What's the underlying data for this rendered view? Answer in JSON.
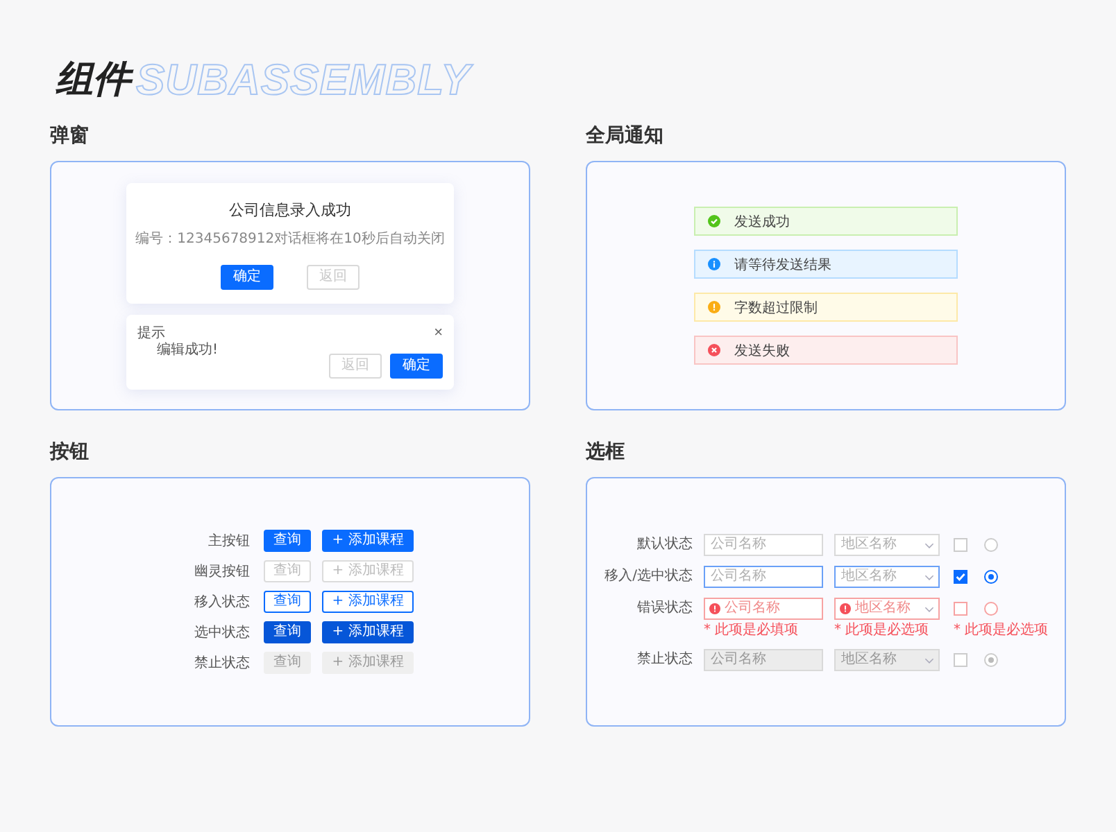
{
  "page_title": "组件",
  "watermark": "SUBASSEMBLY",
  "dialogs": {
    "title": "弹窗",
    "items": [
      {
        "kind": "result",
        "title": "公司信息录入成功",
        "message": "编号：12345678912对话框将在10秒后自动关闭",
        "buttons": [
          {
            "label": "确定",
            "primary": true
          },
          {
            "label": "返回",
            "primary": false
          }
        ]
      },
      {
        "kind": "prompt",
        "title": "提示",
        "message": "编辑成功!",
        "close": "×",
        "buttons": [
          {
            "label": "返回",
            "primary": false
          },
          {
            "label": "确定",
            "primary": true
          }
        ]
      }
    ]
  },
  "notifications": {
    "title": "全局通知",
    "items": [
      {
        "kind": "success",
        "text": "发送成功"
      },
      {
        "kind": "info",
        "text": "请等待发送结果"
      },
      {
        "kind": "warning",
        "text": "字数超过限制"
      },
      {
        "kind": "error",
        "text": "发送失败"
      }
    ]
  },
  "buttons": {
    "title": "按钮",
    "rows": [
      {
        "label": "主按钮",
        "kind": "primary",
        "buttons": [
          "查询",
          "+ 添加课程"
        ]
      },
      {
        "label": "幽灵按钮",
        "kind": "ghost",
        "buttons": [
          "查询",
          "+ 添加课程"
        ]
      },
      {
        "label": "移入状态",
        "kind": "hover",
        "buttons": [
          "查询",
          "+ 添加课程"
        ]
      },
      {
        "label": "选中状态",
        "kind": "active",
        "buttons": [
          "查询",
          "+ 添加课程"
        ]
      },
      {
        "label": "禁止状态",
        "kind": "disabled",
        "buttons": [
          "查询",
          "+ 添加课程"
        ]
      }
    ]
  },
  "fields": {
    "title": "选框",
    "rows": [
      {
        "label": "默认状态",
        "kind": "default",
        "input": {
          "placeholder": "公司名称"
        },
        "select": {
          "placeholder": "地区名称"
        },
        "checked": false,
        "selected": false
      },
      {
        "label": "移入/选中状态",
        "kind": "focus",
        "input": {
          "placeholder": "公司名称"
        },
        "select": {
          "placeholder": "地区名称"
        },
        "checked": true,
        "selected": true
      },
      {
        "label": "错误状态",
        "kind": "error",
        "input": {
          "placeholder": "公司名称",
          "error": "* 此项是必填项"
        },
        "select": {
          "placeholder": "地区名称",
          "error": "* 此项是必选项"
        },
        "checked": false,
        "selected": false,
        "choice_error": "* 此项是必选项"
      },
      {
        "label": "禁止状态",
        "kind": "disabled",
        "input": {
          "placeholder": "公司名称"
        },
        "select": {
          "placeholder": "地区名称"
        },
        "checked": false,
        "selected": true
      }
    ]
  }
}
